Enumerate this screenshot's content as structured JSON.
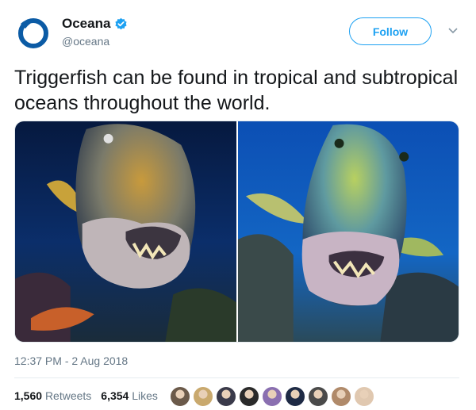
{
  "account": {
    "display_name": "Oceana",
    "handle": "@oceana",
    "verified": true,
    "avatar_icon": "oceana-logo-icon",
    "brand_color": "#0b5ba5"
  },
  "follow_button": {
    "label": "Follow"
  },
  "tweet": {
    "text": "Triggerfish can be found in tropical and subtropical oceans throughout the world."
  },
  "media": {
    "photos": [
      {
        "name": "triggerfish-photo-left"
      },
      {
        "name": "triggerfish-photo-right"
      }
    ]
  },
  "meta": {
    "timestamp": "12:37 PM - 2 Aug 2018"
  },
  "stats": {
    "retweets_count": "1,560",
    "retweets_label": "Retweets",
    "likes_count": "6,354",
    "likes_label": "Likes"
  },
  "liker_avatars": [
    {
      "color": "#6b5a4a"
    },
    {
      "color": "#c9a96e"
    },
    {
      "color": "#3a3a4a"
    },
    {
      "color": "#2a2a2a"
    },
    {
      "color": "#8a6fb0"
    },
    {
      "color": "#1e2a45"
    },
    {
      "color": "#4a4a4a"
    },
    {
      "color": "#b08a6a"
    },
    {
      "color": "#e0c8b0"
    }
  ],
  "colors": {
    "accent": "#1da1f2",
    "muted": "#657786",
    "text": "#14171a"
  }
}
